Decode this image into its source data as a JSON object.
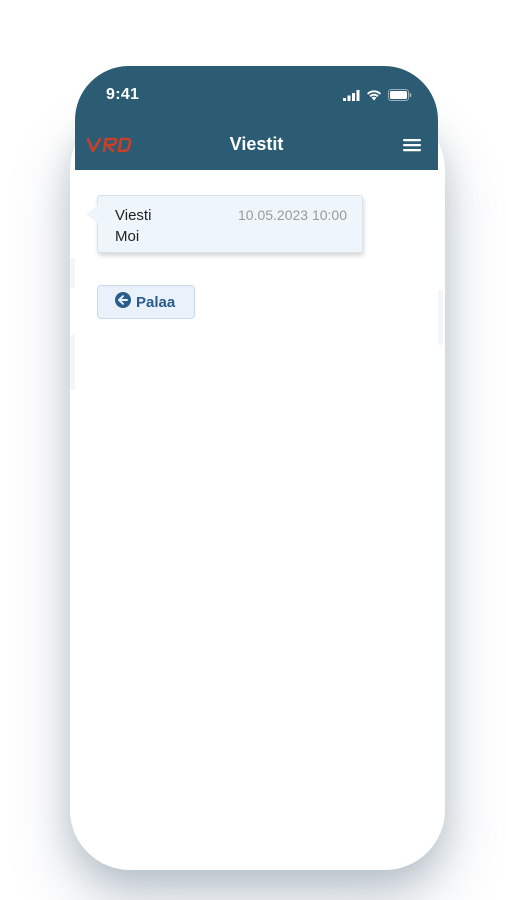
{
  "status_bar": {
    "time": "9:41",
    "icons": [
      "signal-icon",
      "wifi-icon",
      "battery-icon"
    ]
  },
  "navbar": {
    "logo_icon": "vr-logo",
    "title": "Viestit",
    "menu_icon": "hamburger-menu-icon"
  },
  "message": {
    "sender": "Viesti",
    "timestamp": "10.05.2023 10:00",
    "text": "Moi"
  },
  "back_button": {
    "icon": "arrow-circle-left-icon",
    "label": "Palaa"
  },
  "colors": {
    "header": "#2b5c73",
    "logo": "#c8402a",
    "message_bg": "#eef5fb",
    "button_text": "#2b5c8a"
  }
}
